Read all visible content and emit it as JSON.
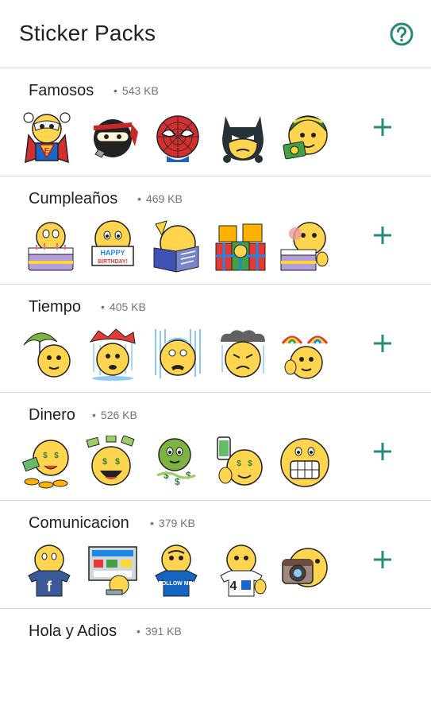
{
  "app": {
    "title": "Sticker Packs",
    "help_icon": "help-circle-icon",
    "accent_color": "#26897a"
  },
  "packs": [
    {
      "name": "Famosos",
      "size": "543 KB",
      "stickers": [
        "superhero-sticker",
        "ninja-sticker",
        "spider-mask-sticker",
        "bat-mask-sticker",
        "soccer-fan-sticker"
      ]
    },
    {
      "name": "Cumpleaños",
      "size": "469 KB",
      "stickers": [
        "birthday-cake-sticker",
        "happy-birthday-sign-sticker",
        "birthday-card-sticker",
        "gift-boxes-sticker",
        "cake-slice-sticker"
      ]
    },
    {
      "name": "Tiempo",
      "size": "405 KB",
      "stickers": [
        "umbrella-sticker",
        "broken-umbrella-sticker",
        "rain-sticker",
        "storm-cloud-sticker",
        "rainbow-sticker"
      ]
    },
    {
      "name": "Dinero",
      "size": "526 KB",
      "stickers": [
        "coins-sticker",
        "money-rain-sticker",
        "green-dollar-sticker",
        "phone-money-sticker",
        "grin-sticker"
      ]
    },
    {
      "name": "Comunicacion",
      "size": "379 KB",
      "stickers": [
        "facebook-shirt-sticker",
        "computer-screen-sticker",
        "follow-me-shirt-sticker",
        "number-four-sticker",
        "camera-sticker"
      ],
      "shirt_text": "FOLLOW ME!",
      "number_text": "4"
    },
    {
      "name": "Hola y Adios",
      "size": "391 KB",
      "stickers": []
    }
  ],
  "sticker_labels": {
    "happy": "HAPPY",
    "birthday": "BIRTHDAY!"
  }
}
